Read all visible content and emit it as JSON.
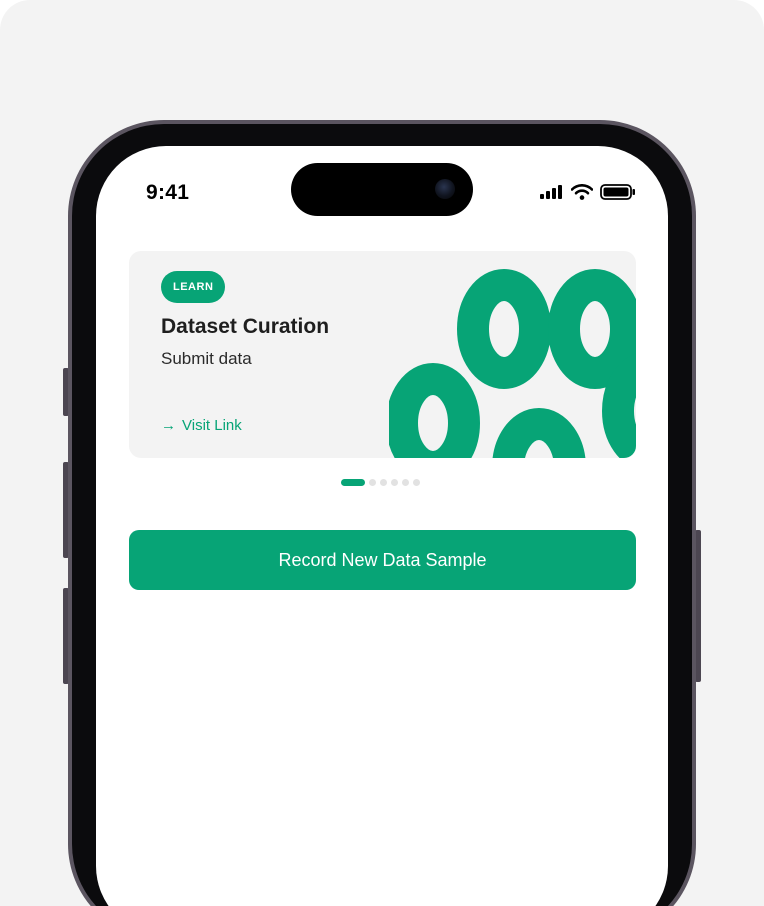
{
  "status_bar": {
    "time": "9:41",
    "icons": [
      "cellular-signal-icon",
      "wifi-icon",
      "battery-icon"
    ]
  },
  "promo_card": {
    "badge": "LEARN",
    "title": "Dataset Curation",
    "subtitle": "Submit data",
    "link_arrow": "→",
    "link_label": "Visit Link",
    "decoration": "green-rings-pattern"
  },
  "carousel": {
    "total_pages": 6,
    "active_index": 0
  },
  "primary_action": {
    "label": "Record New Data Sample"
  },
  "colors": {
    "accent": "#07a476",
    "card_background": "#f3f3f3",
    "page_background": "#f3f3f3",
    "screen_background": "#ffffff"
  }
}
